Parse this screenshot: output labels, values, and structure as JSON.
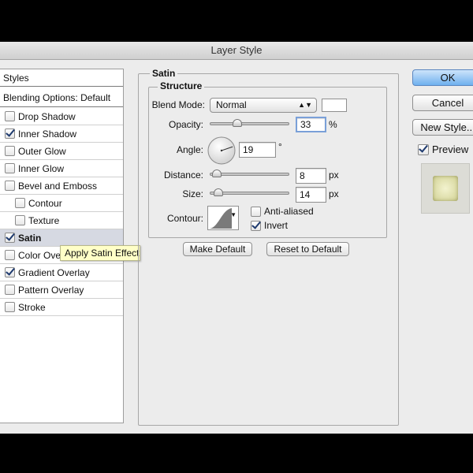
{
  "window": {
    "title": "Layer Style"
  },
  "styles_list": {
    "header": "Styles",
    "blending_options": "Blending Options: Default",
    "items": [
      {
        "label": "Drop Shadow",
        "checked": false,
        "indent": false
      },
      {
        "label": "Inner Shadow",
        "checked": true,
        "indent": false
      },
      {
        "label": "Outer Glow",
        "checked": false,
        "indent": false
      },
      {
        "label": "Inner Glow",
        "checked": false,
        "indent": false
      },
      {
        "label": "Bevel and Emboss",
        "checked": false,
        "indent": false
      },
      {
        "label": "Contour",
        "checked": false,
        "indent": true
      },
      {
        "label": "Texture",
        "checked": false,
        "indent": true
      },
      {
        "label": "Satin",
        "checked": true,
        "indent": false,
        "selected": true
      },
      {
        "label": "Color Overlay",
        "checked": false,
        "indent": false
      },
      {
        "label": "Gradient Overlay",
        "checked": true,
        "indent": false
      },
      {
        "label": "Pattern Overlay",
        "checked": false,
        "indent": false
      },
      {
        "label": "Stroke",
        "checked": false,
        "indent": false
      }
    ]
  },
  "tooltip": "Apply Satin Effect",
  "satin": {
    "title": "Satin",
    "structure": {
      "title": "Structure",
      "blend_mode_label": "Blend Mode:",
      "blend_mode_value": "Normal",
      "color_swatch": "#ffffff",
      "opacity_label": "Opacity:",
      "opacity_value": "33",
      "opacity_unit": "%",
      "opacity_level": 0.33,
      "angle_label": "Angle:",
      "angle_value": "19",
      "angle_unit": "°",
      "distance_label": "Distance:",
      "distance_value": "8",
      "distance_unit": "px",
      "distance_level": 0.03,
      "size_label": "Size:",
      "size_value": "14",
      "size_unit": "px",
      "size_level": 0.06,
      "contour_label": "Contour:",
      "anti_aliased_label": "Anti-aliased",
      "anti_aliased": false,
      "invert_label": "Invert",
      "invert": true
    },
    "make_default_label": "Make Default",
    "reset_default_label": "Reset to Default"
  },
  "buttons": {
    "ok": "OK",
    "cancel": "Cancel",
    "new_style": "New Style...",
    "preview_label": "Preview",
    "preview_checked": true
  },
  "colors": {
    "accent": "#6fb0ee",
    "selected_row": "#d6d9e2",
    "tooltip_bg": "#ffffc7"
  }
}
